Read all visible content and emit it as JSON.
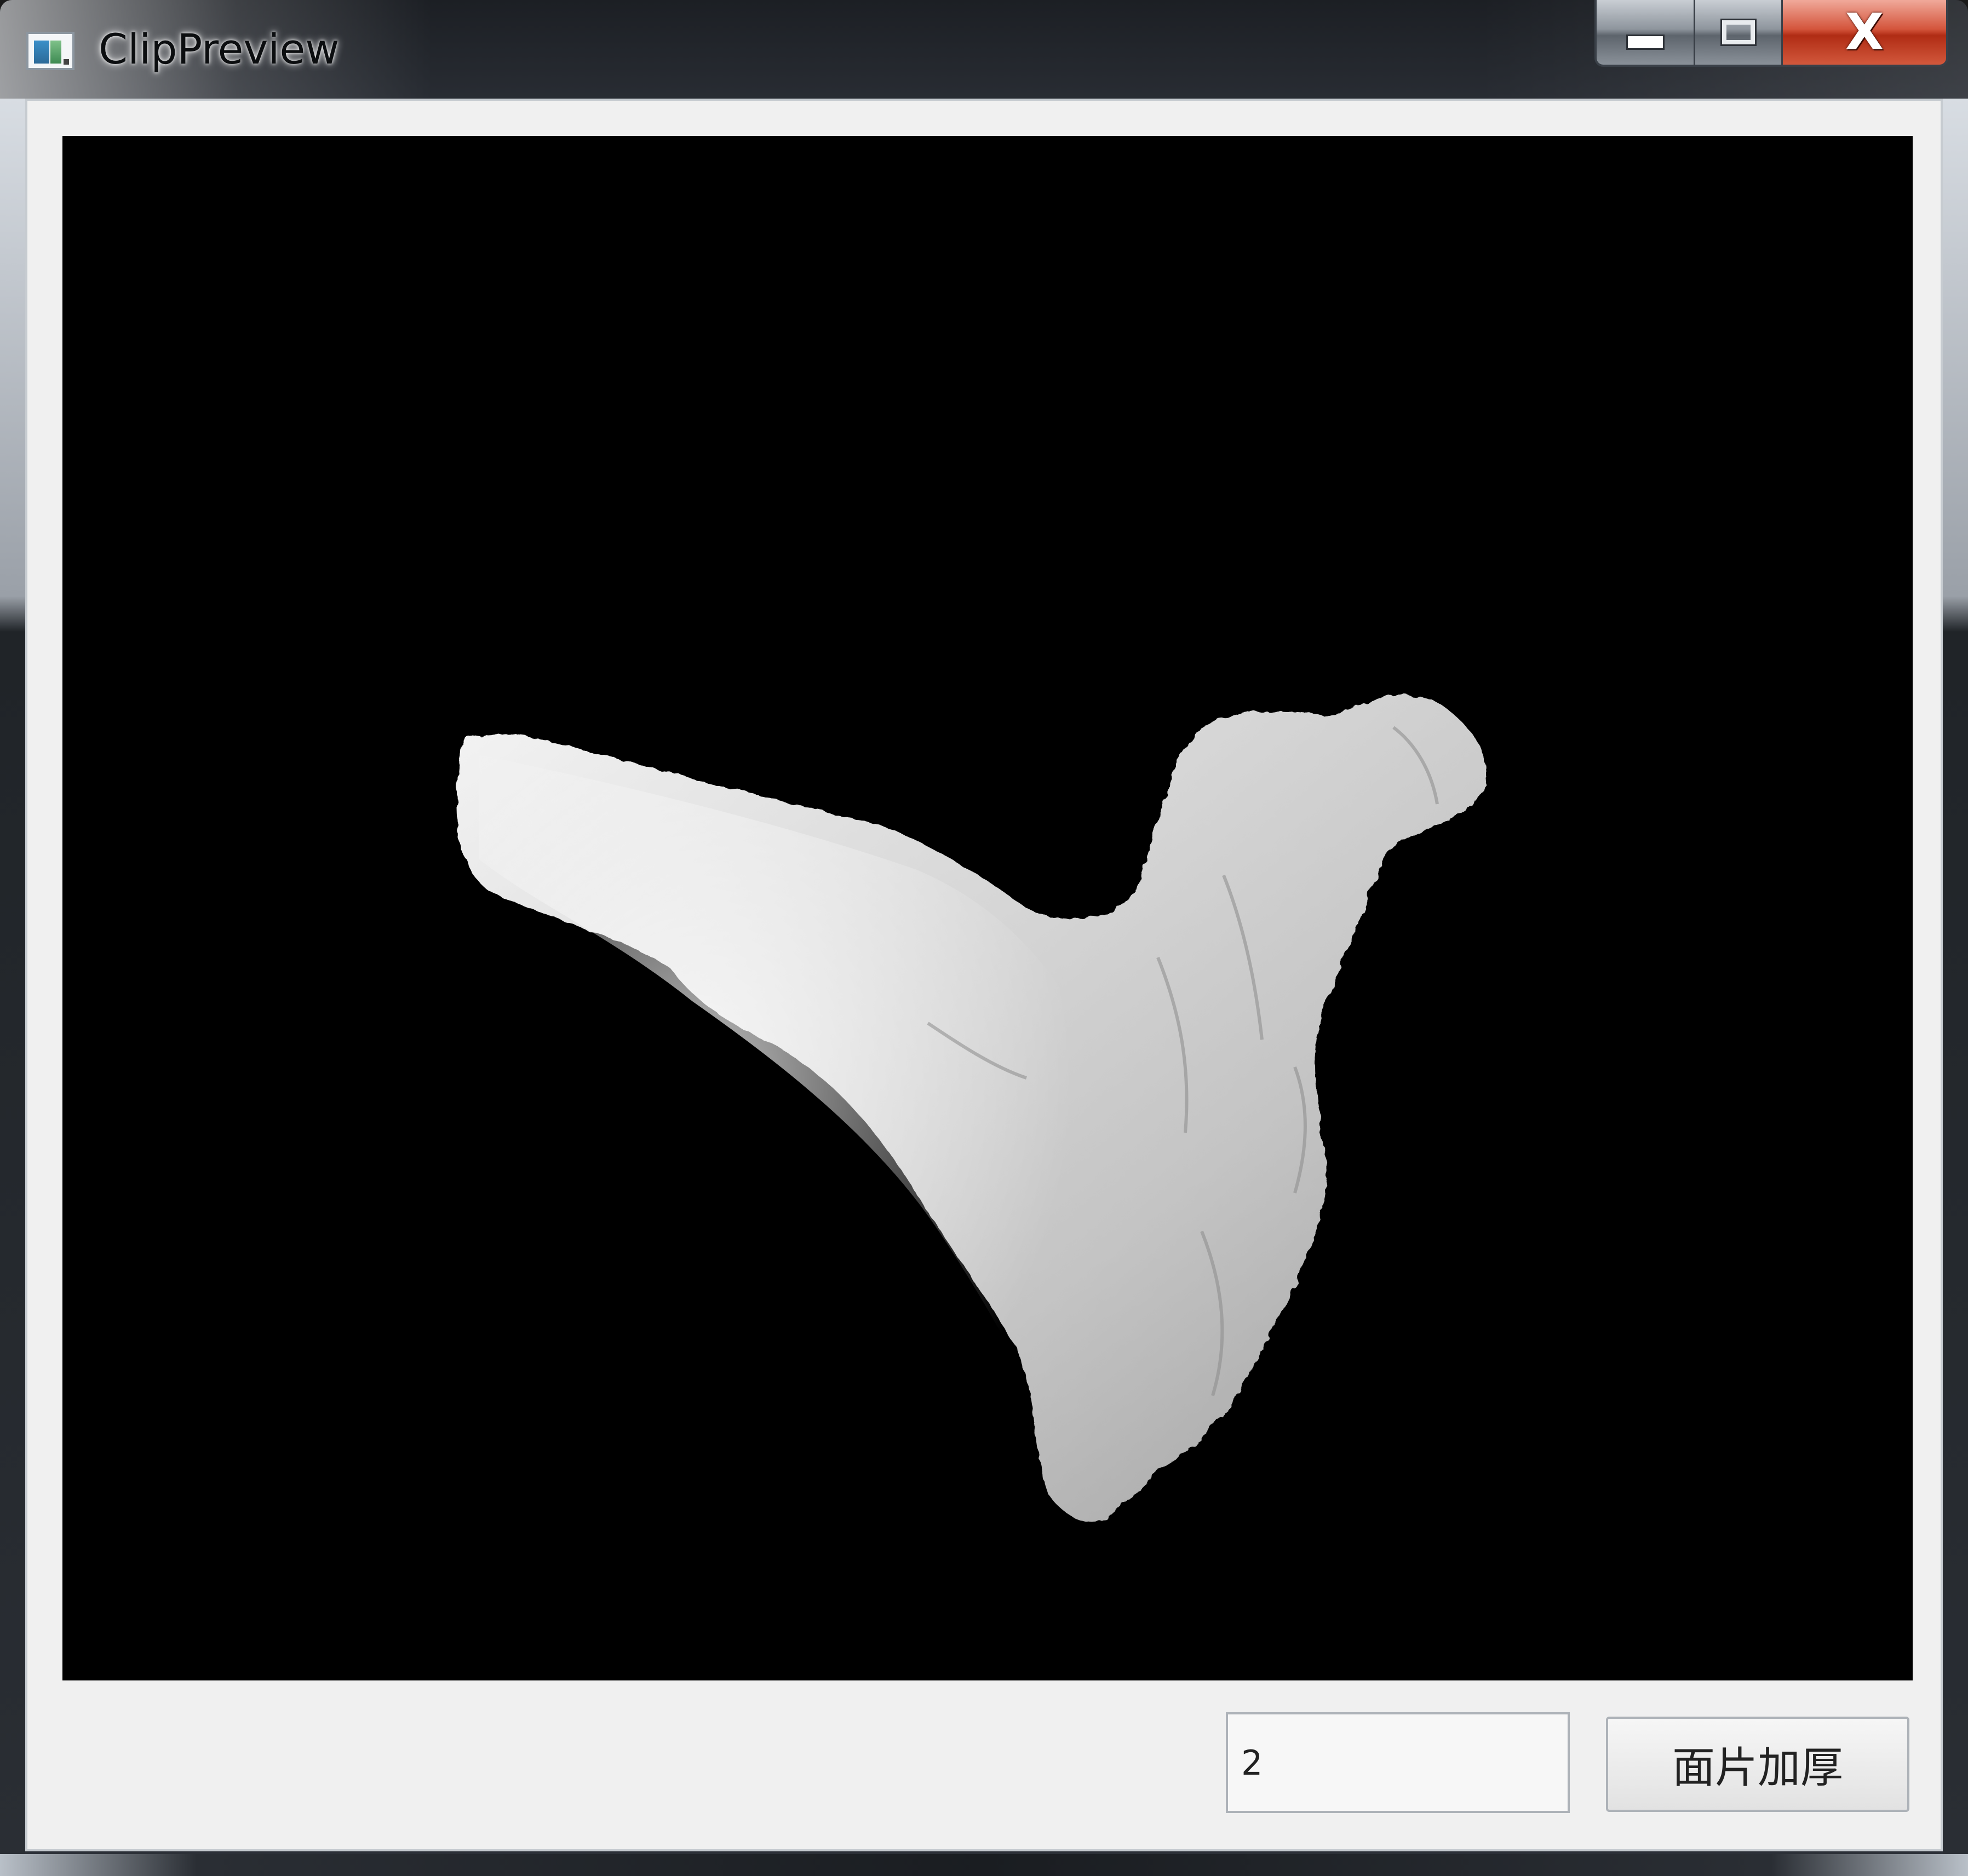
{
  "window": {
    "title": "ClipPreview",
    "icon": "app-icon",
    "controls": {
      "minimize_icon": "minimize-icon",
      "maximize_icon": "maximize-icon",
      "close_icon": "close-icon",
      "close_glyph": "X"
    }
  },
  "viewport": {
    "background": "#000000",
    "model": "3d-bone-mesh",
    "model_color": "#e6e6e6"
  },
  "controls": {
    "thickness_value": "2",
    "thicken_label": "面片加厚"
  }
}
